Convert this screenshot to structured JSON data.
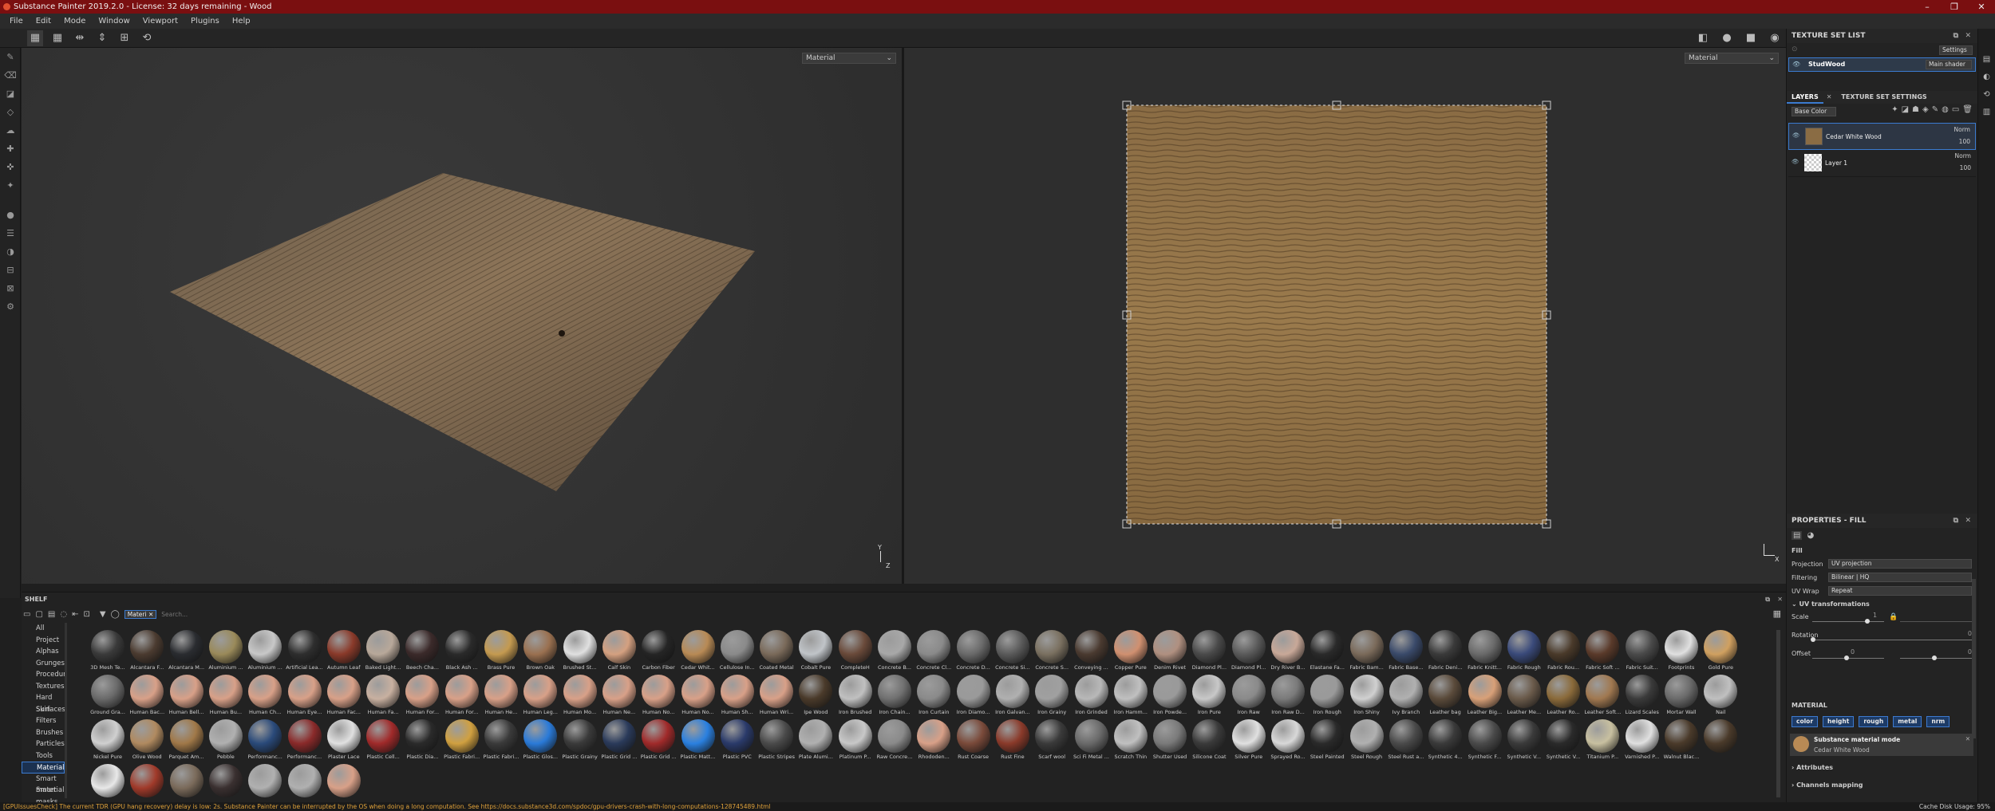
{
  "app": {
    "title": "Substance Painter 2019.2.0 - License: 32 days remaining - Wood"
  },
  "window_controls": [
    "–",
    "❐",
    "✕"
  ],
  "menu": [
    "File",
    "Edit",
    "Mode",
    "Window",
    "Viewport",
    "Plugins",
    "Help"
  ],
  "viewport": {
    "left_dropdown": "Material",
    "right_dropdown": "Material",
    "axis_y": "Y",
    "axis_z": "Z",
    "axis_x": "X"
  },
  "texture_set_list": {
    "title": "TEXTURE SET LIST",
    "settings_label": "Settings",
    "set_name": "StudWood",
    "shader": "Main shader"
  },
  "layers": {
    "tab_layers": "LAYERS",
    "tab_settings": "TEXTURE SET SETTINGS",
    "channel": "Base Color",
    "items": [
      {
        "name": "Cedar White Wood",
        "blend": "Norm",
        "opacity": "100"
      },
      {
        "name": "Layer 1",
        "blend": "Norm",
        "opacity": "100"
      }
    ]
  },
  "properties": {
    "title": "PROPERTIES - FILL",
    "fill_heading": "Fill",
    "projection_label": "Projection",
    "projection_value": "UV projection",
    "filtering_label": "Filtering",
    "filtering_value": "Bilinear | HQ",
    "uvwrap_label": "UV Wrap",
    "uvwrap_value": "Repeat",
    "uv_section": "UV transformations",
    "scale_label": "Scale",
    "scale_value": "1",
    "rotation_label": "Rotation",
    "rotation_value": "0",
    "offset_label": "Offset",
    "offset_x": "0",
    "offset_y": "0",
    "material_heading": "MATERIAL",
    "channels": [
      "color",
      "height",
      "rough",
      "metal",
      "nrm"
    ],
    "material_mode": "Substance material mode",
    "material_name": "Cedar White Wood",
    "attributes": "Attributes",
    "channels_mapping": "Channels mapping"
  },
  "shelf": {
    "title": "SHELF",
    "filter_tag": "Materi",
    "search_placeholder": "Search...",
    "categories": [
      "All",
      "Project",
      "Alphas",
      "Grunges",
      "Procedurals",
      "Textures",
      "Hard Surfaces",
      "Skin",
      "Filters",
      "Brushes",
      "Particles",
      "Tools",
      "Materials",
      "Smart materials",
      "Smart masks"
    ],
    "selected_category": "Materials",
    "materials": [
      {
        "n": "3D Mesh Te...",
        "c": "#3a3a3a"
      },
      {
        "n": "Alcantara F...",
        "c": "#4b3b30"
      },
      {
        "n": "Alcantara M...",
        "c": "#2a2c30"
      },
      {
        "n": "Aluminium ...",
        "c": "#9a8a5a"
      },
      {
        "n": "Aluminium ...",
        "c": "#c8c8c8"
      },
      {
        "n": "Artificial Lea...",
        "c": "#2e2e2e"
      },
      {
        "n": "Autumn Leaf",
        "c": "#8a3a2a"
      },
      {
        "n": "Baked Light...",
        "c": "#b8a89a"
      },
      {
        "n": "Beech Cha...",
        "c": "#3b2a2a"
      },
      {
        "n": "Black Ash ...",
        "c": "#2a2a2a"
      },
      {
        "n": "Brass Pure",
        "c": "#c49a50"
      },
      {
        "n": "Brown Oak",
        "c": "#9a7050"
      },
      {
        "n": "Brushed St...",
        "c": "#e0e0e0"
      },
      {
        "n": "Calf Skin",
        "c": "#d4a080"
      },
      {
        "n": "Carbon Fiber",
        "c": "#252525"
      },
      {
        "n": "Cedar Whit...",
        "c": "#b88a55"
      },
      {
        "n": "Cellulose In...",
        "c": "#8a8a8a"
      },
      {
        "n": "Coated Metal",
        "c": "#7a6a5a"
      },
      {
        "n": "Cobalt Pure",
        "c": "#c0c4c8"
      },
      {
        "n": "CompleteH",
        "c": "#6a4a3a"
      },
      {
        "n": "Concrete B...",
        "c": "#a8a8a8"
      },
      {
        "n": "Concrete Cl...",
        "c": "#8a8a8a"
      },
      {
        "n": "Concrete D...",
        "c": "#6a6a6a"
      },
      {
        "n": "Concrete Si...",
        "c": "#5a5a5a"
      },
      {
        "n": "Concrete S...",
        "c": "#7a7060"
      },
      {
        "n": "Conveying ...",
        "c": "#4a3a30"
      },
      {
        "n": "Copper Pure",
        "c": "#d09070"
      },
      {
        "n": "Denim Rivet",
        "c": "#b09080"
      },
      {
        "n": "Diamond Pl...",
        "c": "#4a4a4a"
      },
      {
        "n": "Diamond Pl...",
        "c": "#5a5a5a"
      },
      {
        "n": "Dry River B...",
        "c": "#c8a898"
      },
      {
        "n": "Elastane Fa...",
        "c": "#2a2a2a"
      },
      {
        "n": "Fabric Bam...",
        "c": "#7a6a5a"
      },
      {
        "n": "Fabric Base...",
        "c": "#3a4a6a"
      },
      {
        "n": "Fabric Deni...",
        "c": "#3a3a3a"
      },
      {
        "n": "Fabric Knitt...",
        "c": "#6a6a6a"
      },
      {
        "n": "Fabric Rough",
        "c": "#3a4a7a"
      },
      {
        "n": "Fabric Rou...",
        "c": "#4a3a2a"
      },
      {
        "n": "Fabric Soft ...",
        "c": "#5a3a2a"
      },
      {
        "n": "Fabric Suit...",
        "c": "#4a4a4a"
      },
      {
        "n": "Footprints",
        "c": "#e0e0e0"
      },
      {
        "n": "Gold Pure",
        "c": "#d0a060"
      },
      {
        "n": "Ground Gra...",
        "c": "#6a6a6a"
      },
      {
        "n": "Human Bac...",
        "c": "#d8a088"
      },
      {
        "n": "Human Bell...",
        "c": "#d8a088"
      },
      {
        "n": "Human Bu...",
        "c": "#d8a088"
      },
      {
        "n": "Human Ch...",
        "c": "#d8a088"
      },
      {
        "n": "Human Eye...",
        "c": "#d8a088"
      },
      {
        "n": "Human Fac...",
        "c": "#d8a088"
      },
      {
        "n": "Human Fa...",
        "c": "#c8b0a0"
      },
      {
        "n": "Human For...",
        "c": "#d8a088"
      },
      {
        "n": "Human For...",
        "c": "#d8a088"
      },
      {
        "n": "Human He...",
        "c": "#d8a088"
      },
      {
        "n": "Human Leg...",
        "c": "#d8a088"
      },
      {
        "n": "Human Mo...",
        "c": "#d8a088"
      },
      {
        "n": "Human Ne...",
        "c": "#d8a088"
      },
      {
        "n": "Human No...",
        "c": "#d8a088"
      },
      {
        "n": "Human No...",
        "c": "#d8a088"
      },
      {
        "n": "Human Sh...",
        "c": "#d8a088"
      },
      {
        "n": "Human Wri...",
        "c": "#d8a088"
      },
      {
        "n": "Ipe Wood",
        "c": "#4a3a2a"
      },
      {
        "n": "Iron Brushed",
        "c": "#c0c0c0"
      },
      {
        "n": "Iron Chain...",
        "c": "#707070"
      },
      {
        "n": "Iron Curtain",
        "c": "#8a8a8a"
      },
      {
        "n": "Iron Diamo...",
        "c": "#9a9a9a"
      },
      {
        "n": "Iron Galvan...",
        "c": "#b0b0b0"
      },
      {
        "n": "Iron Grainy",
        "c": "#a0a0a0"
      },
      {
        "n": "Iron Grinded",
        "c": "#b8b8b8"
      },
      {
        "n": "Iron Hamm...",
        "c": "#c0c0c0"
      },
      {
        "n": "Iron Powde...",
        "c": "#9a9a9a"
      },
      {
        "n": "Iron Pure",
        "c": "#c8c8c8"
      },
      {
        "n": "Iron Raw",
        "c": "#8a8a8a"
      },
      {
        "n": "Iron Raw D...",
        "c": "#7a7a7a"
      },
      {
        "n": "Iron Rough",
        "c": "#9a9a9a"
      },
      {
        "n": "Iron Shiny",
        "c": "#d0d0d0"
      },
      {
        "n": "Ivy Branch",
        "c": "#b0b0b0"
      },
      {
        "n": "Leather bag",
        "c": "#5a4a3a"
      },
      {
        "n": "Leather Big...",
        "c": "#d8a078"
      },
      {
        "n": "Leather Me...",
        "c": "#6a5a4a"
      },
      {
        "n": "Leather Ro...",
        "c": "#8a6a3a"
      },
      {
        "n": "Leather Soft...",
        "c": "#a07850"
      },
      {
        "n": "Lizard Scales",
        "c": "#3a3a3a"
      },
      {
        "n": "Mortar Wall",
        "c": "#6a6a6a"
      },
      {
        "n": "Nail",
        "c": "#c0c0c0"
      },
      {
        "n": "Nickel Pure",
        "c": "#d0d0d0"
      },
      {
        "n": "Olive Wood",
        "c": "#b08a60"
      },
      {
        "n": "Parquet Am...",
        "c": "#a07848"
      },
      {
        "n": "Pebble",
        "c": "#b0b0b0"
      },
      {
        "n": "Performanc...",
        "c": "#2a4a7a"
      },
      {
        "n": "Performanc...",
        "c": "#8a2a2a"
      },
      {
        "n": "Plaster Lace",
        "c": "#e0e0e0"
      },
      {
        "n": "Plastic Cell...",
        "c": "#a02a2a"
      },
      {
        "n": "Plastic Dia...",
        "c": "#2a2a2a"
      },
      {
        "n": "Plastic Fabri...",
        "c": "#d0a040"
      },
      {
        "n": "Plastic Fabri...",
        "c": "#3a3a3a"
      },
      {
        "n": "Plastic Glos...",
        "c": "#2a7ad8"
      },
      {
        "n": "Plastic Grainy",
        "c": "#3a3a3a"
      },
      {
        "n": "Plastic Grid ...",
        "c": "#2a3a5a"
      },
      {
        "n": "Plastic Grid ...",
        "c": "#a02a2a"
      },
      {
        "n": "Plastic Matt...",
        "c": "#2a80e0"
      },
      {
        "n": "Plastic PVC",
        "c": "#2a3a6a"
      },
      {
        "n": "Plastic Stripes",
        "c": "#4a4a4a"
      },
      {
        "n": "Plate Alumi...",
        "c": "#b0b0b0"
      },
      {
        "n": "Platinum P...",
        "c": "#c8c8c8"
      },
      {
        "n": "Raw Concre...",
        "c": "#8a8a8a"
      },
      {
        "n": "Rhododen...",
        "c": "#d8a088"
      },
      {
        "n": "Rust Coarse",
        "c": "#7a4a3a"
      },
      {
        "n": "Rust Fine",
        "c": "#8a3a2a"
      },
      {
        "n": "Scarf wool",
        "c": "#3a3a3a"
      },
      {
        "n": "Sci Fi Metal ...",
        "c": "#6a6a6a"
      },
      {
        "n": "Scratch Thin",
        "c": "#c0c0c0"
      },
      {
        "n": "Shutter Used",
        "c": "#7a7a7a"
      },
      {
        "n": "Silicone Coat",
        "c": "#3a3a3a"
      },
      {
        "n": "Silver Pure",
        "c": "#e0e0e0"
      },
      {
        "n": "Sprayed Ro...",
        "c": "#d8d8d8"
      },
      {
        "n": "Steel Painted",
        "c": "#2a2a2a"
      },
      {
        "n": "Steel Rough",
        "c": "#b0b0b0"
      },
      {
        "n": "Steel Rust a...",
        "c": "#4a4a4a"
      },
      {
        "n": "Synthetic 4...",
        "c": "#3a3a3a"
      },
      {
        "n": "Synthetic F...",
        "c": "#4a4a4a"
      },
      {
        "n": "Synthetic V...",
        "c": "#3a3a3a"
      },
      {
        "n": "Synthetic V...",
        "c": "#2a2a2a"
      },
      {
        "n": "Titanium P...",
        "c": "#c8c0a0"
      },
      {
        "n": "Varnished P...",
        "c": "#e0e0e0"
      },
      {
        "n": "Walnut Blac...",
        "c": "#4a3a2a"
      },
      {
        "n": "",
        "c": "#4a3a2a"
      },
      {
        "n": "",
        "c": "#e8e8e8"
      },
      {
        "n": "",
        "c": "#a03a2a"
      },
      {
        "n": "",
        "c": "#7a6a5a"
      },
      {
        "n": "",
        "c": "#3a3030"
      },
      {
        "n": "",
        "c": "#b0b0b0"
      },
      {
        "n": "",
        "c": "#b0b0b0"
      },
      {
        "n": "",
        "c": "#d8a088"
      }
    ]
  },
  "status": {
    "message": "[GPUIssuesCheck] The current TDR (GPU hang recovery) delay is low: 2s. Substance Painter can be interrupted by the OS when doing a long computation. See https://docs.substance3d.com/spdoc/gpu-drivers-crash-with-long-computations-128745489.html",
    "cache": "Cache Disk Usage:",
    "cache_value": "95%"
  },
  "colors": {
    "titlebar": "#7a0f10",
    "accent": "#3b7bd0",
    "status_warning": "#e0a23a"
  }
}
